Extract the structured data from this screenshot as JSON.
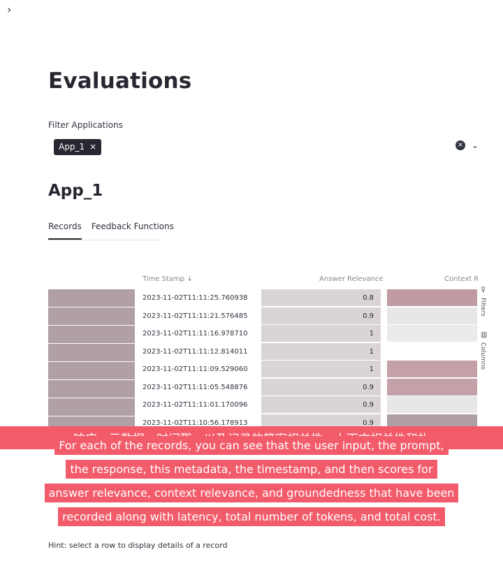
{
  "sidebar_toggle": "›",
  "page_title": "Evaluations",
  "filter": {
    "label": "Filter Applications",
    "chip": "App_1",
    "chip_close": "×",
    "clear": "×",
    "expand": "⌄"
  },
  "app_title": "App_1",
  "tabs": [
    "Records",
    "Feedback Functions"
  ],
  "table": {
    "headers": {
      "time_stamp": "Time Stamp ↓",
      "answer_relevance": "Answer Relevance",
      "context_relevance": "Context R"
    },
    "side_tools": {
      "filters": "Filters",
      "columns": "Columns"
    },
    "rows": [
      {
        "time": "2023-11-02T11:11:25.760938",
        "answer": "0.8",
        "context_color": "#c09ca2"
      },
      {
        "time": "2023-11-02T11:11:21.576485",
        "answer": "0.9",
        "context_color": "#e8e6e6"
      },
      {
        "time": "2023-11-02T11:11:16.978710",
        "answer": "1",
        "context_color": "#ecebeb"
      },
      {
        "time": "2023-11-02T11:11:12.814011",
        "answer": "1",
        "context_color": "#ffffff"
      },
      {
        "time": "2023-11-02T11:11:09.529060",
        "answer": "1",
        "context_color": "#c4a1a8"
      },
      {
        "time": "2023-11-02T11:11:05.548876",
        "answer": "0.9",
        "context_color": "#c4a1a8"
      },
      {
        "time": "2023-11-02T11:11:01.170096",
        "answer": "0.9",
        "context_color": "#e8e6e6"
      },
      {
        "time": "2023-11-02T11:10:56.178913",
        "answer": "0.9",
        "context_color": "#b09fa5"
      }
    ]
  },
  "hint": "Hint: select a row to display details of a record",
  "subtitles": {
    "zh": "响应，元数据，时间戳，以及记录的答案相关性、上下文相关性和扎",
    "en": [
      "For each of the records, you can see that the user input, the prompt,",
      "the response, this metadata, the timestamp, and then scores for",
      "answer relevance, context relevance, and groundedness that have been",
      "recorded along with latency, total number of tokens, and total cost."
    ]
  }
}
